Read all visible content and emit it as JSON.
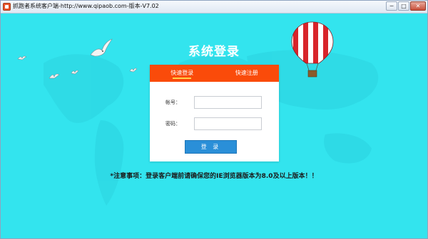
{
  "window": {
    "title": "抓跑者系统客户端-http://www.qipaob.com-版本-V7.02",
    "minimize_label": "─",
    "maximize_label": "□",
    "close_label": "✕"
  },
  "login": {
    "title": "系统登录",
    "tabs": [
      {
        "label": "快速登录",
        "active": true
      },
      {
        "label": "快速注册",
        "active": false
      }
    ],
    "account_label": "帐号：",
    "account_value": "",
    "password_label": "密码：",
    "password_value": "",
    "submit_label": "登 录"
  },
  "notice": "*注意事项：登录客户端前请确保您的IE浏览器版本为8.0及以上版本！！",
  "colors": {
    "background": "#33e4ee",
    "tab_bar": "#fa4b0a",
    "button": "#2a8fd8"
  },
  "icons": [
    "app-icon",
    "hot-air-balloon",
    "seagull"
  ]
}
